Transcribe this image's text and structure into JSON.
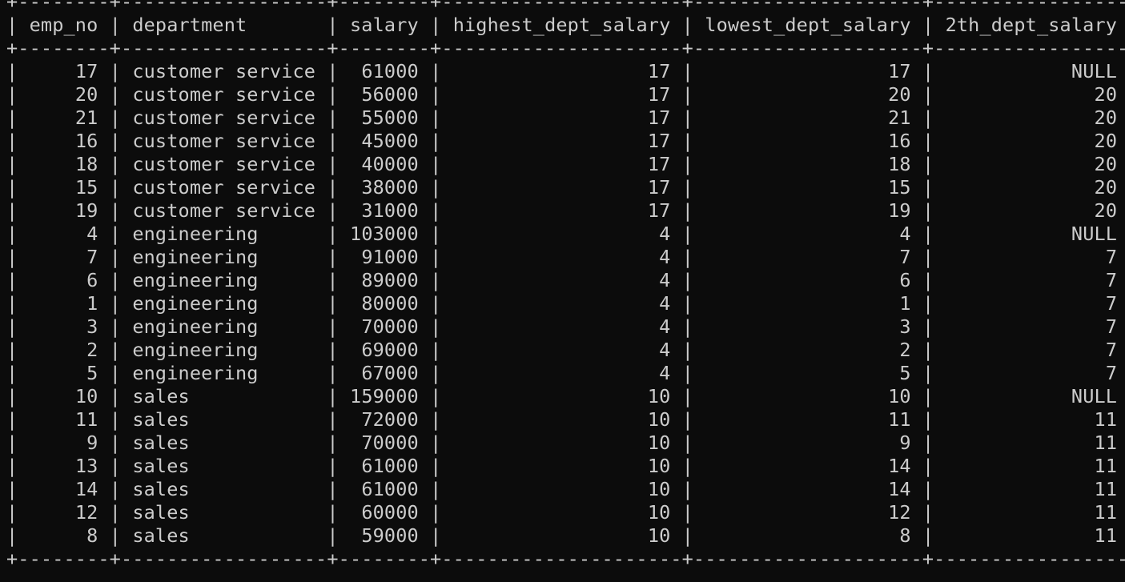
{
  "columns": [
    "emp_no",
    "department",
    "salary",
    "highest_dept_salary",
    "lowest_dept_salary",
    "2th_dept_salary"
  ],
  "align": [
    "right",
    "left",
    "right",
    "right",
    "right",
    "right"
  ],
  "rows": [
    [
      "17",
      "customer service",
      "61000",
      "17",
      "17",
      "NULL"
    ],
    [
      "20",
      "customer service",
      "56000",
      "17",
      "20",
      "20"
    ],
    [
      "21",
      "customer service",
      "55000",
      "17",
      "21",
      "20"
    ],
    [
      "16",
      "customer service",
      "45000",
      "17",
      "16",
      "20"
    ],
    [
      "18",
      "customer service",
      "40000",
      "17",
      "18",
      "20"
    ],
    [
      "15",
      "customer service",
      "38000",
      "17",
      "15",
      "20"
    ],
    [
      "19",
      "customer service",
      "31000",
      "17",
      "19",
      "20"
    ],
    [
      "4",
      "engineering",
      "103000",
      "4",
      "4",
      "NULL"
    ],
    [
      "7",
      "engineering",
      "91000",
      "4",
      "7",
      "7"
    ],
    [
      "6",
      "engineering",
      "89000",
      "4",
      "6",
      "7"
    ],
    [
      "1",
      "engineering",
      "80000",
      "4",
      "1",
      "7"
    ],
    [
      "3",
      "engineering",
      "70000",
      "4",
      "3",
      "7"
    ],
    [
      "2",
      "engineering",
      "69000",
      "4",
      "2",
      "7"
    ],
    [
      "5",
      "engineering",
      "67000",
      "4",
      "5",
      "7"
    ],
    [
      "10",
      "sales",
      "159000",
      "10",
      "10",
      "NULL"
    ],
    [
      "11",
      "sales",
      "72000",
      "10",
      "11",
      "11"
    ],
    [
      "9",
      "sales",
      "70000",
      "10",
      "9",
      "11"
    ],
    [
      "13",
      "sales",
      "61000",
      "10",
      "14",
      "11"
    ],
    [
      "14",
      "sales",
      "61000",
      "10",
      "14",
      "11"
    ],
    [
      "12",
      "sales",
      "60000",
      "10",
      "12",
      "11"
    ],
    [
      "8",
      "sales",
      "59000",
      "10",
      "8",
      "11"
    ]
  ],
  "colors": {
    "background": "#0c0c0c",
    "foreground": "#cccccc"
  }
}
